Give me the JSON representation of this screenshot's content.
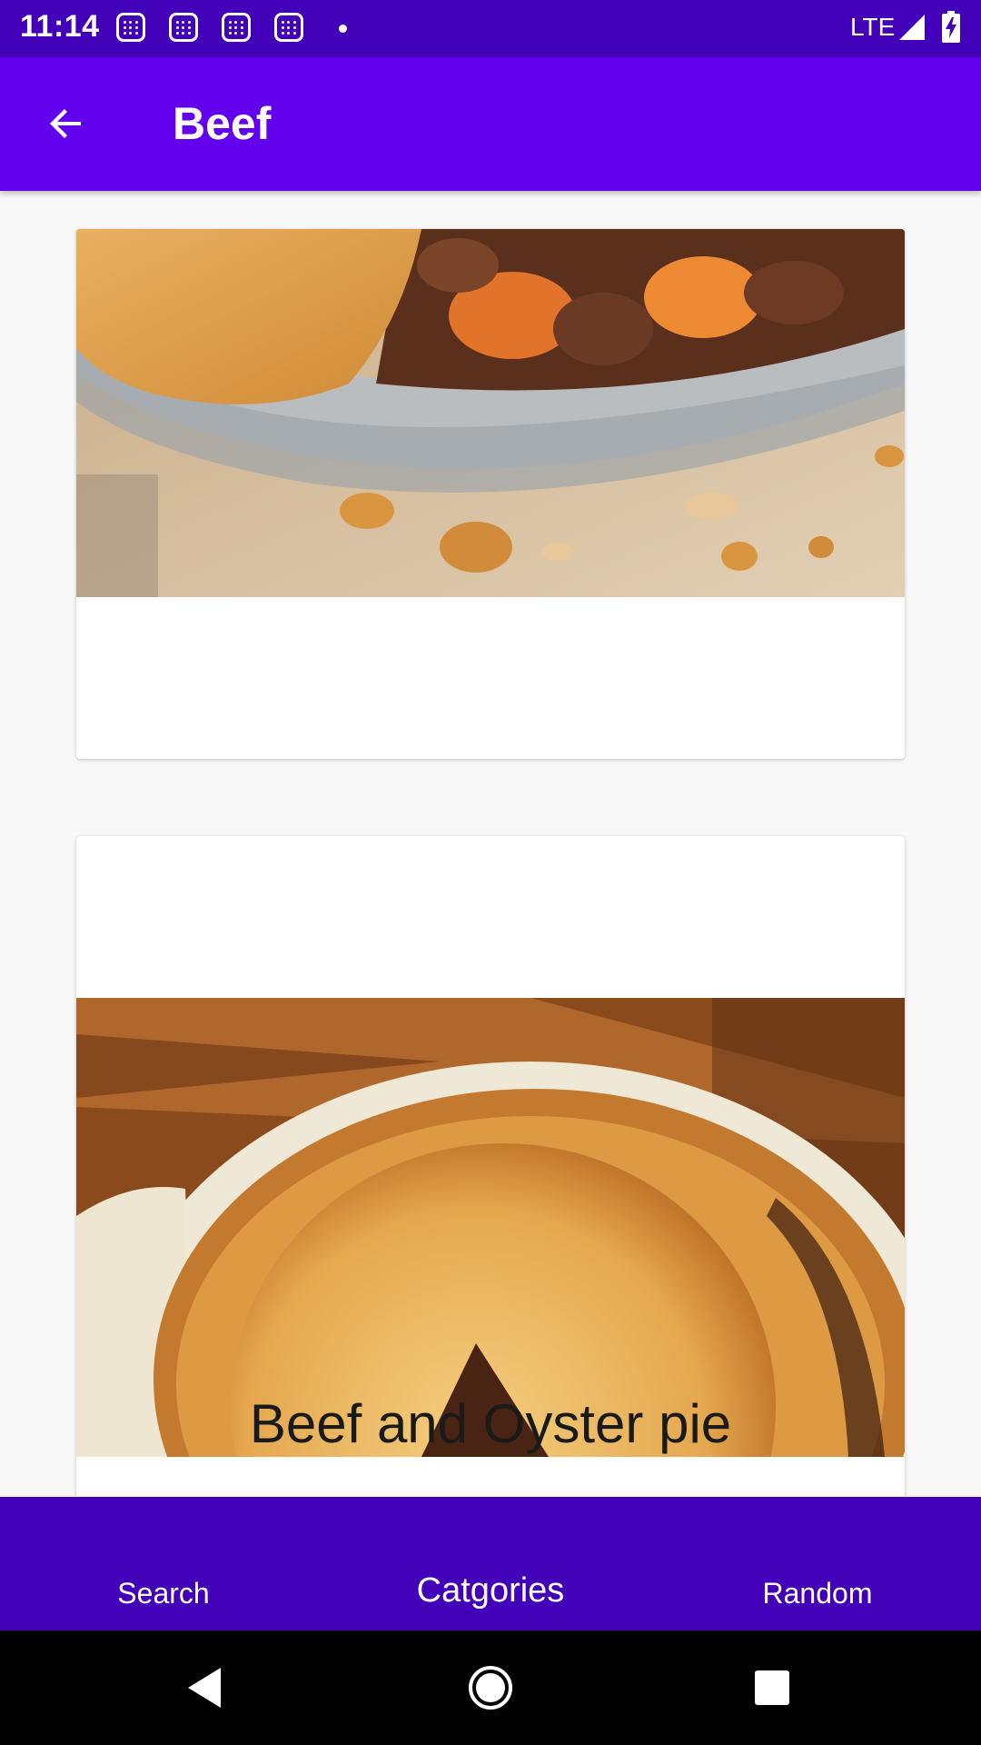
{
  "status_bar": {
    "time": "11:14",
    "network": "LTE",
    "icons": [
      "notification-icon",
      "notification-icon",
      "notification-icon",
      "notification-icon",
      "dot-icon",
      "signal-icon",
      "battery-charging-icon"
    ]
  },
  "app_bar": {
    "title": "Beef",
    "back_icon": "arrow-back-icon"
  },
  "meals": [
    {
      "name": ""
    },
    {
      "name": "Beef and Oyster pie"
    }
  ],
  "bottom_nav": {
    "items": [
      {
        "label": "Search"
      },
      {
        "label": "Catgories"
      },
      {
        "label": "Random"
      }
    ],
    "active_index": 1
  },
  "system_nav": {
    "icons": [
      "back-triangle-icon",
      "home-circle-icon",
      "recents-square-icon"
    ]
  },
  "colors": {
    "status_bar": "#4200b8",
    "app_bar": "#6200ee",
    "bottom_nav": "#4200b8",
    "background": "#f8f8f8"
  }
}
